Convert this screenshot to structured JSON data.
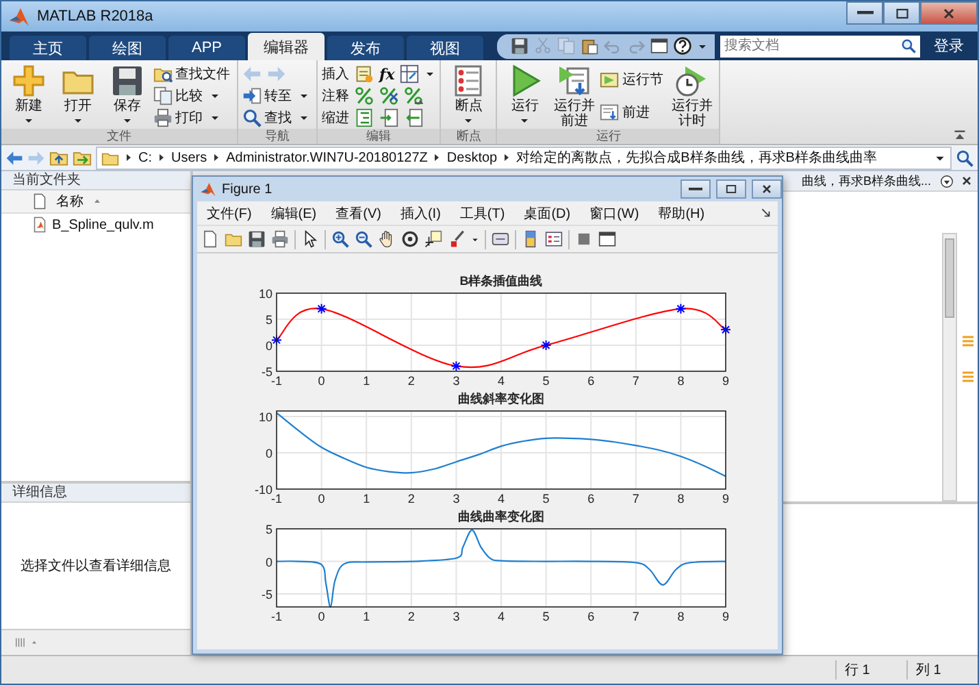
{
  "window": {
    "title": "MATLAB R2018a"
  },
  "tabs": [
    {
      "label": "主页",
      "selected": false
    },
    {
      "label": "绘图",
      "selected": false
    },
    {
      "label": "APP",
      "selected": false
    },
    {
      "label": "编辑器",
      "selected": true
    },
    {
      "label": "发布",
      "selected": false
    },
    {
      "label": "视图",
      "selected": false
    }
  ],
  "search": {
    "placeholder": "搜索文档"
  },
  "login": "登录",
  "ribbon": {
    "groups": [
      {
        "title": "文件",
        "columns": [
          {
            "kind": "large",
            "label": "新建",
            "dropdown": true
          },
          {
            "kind": "large",
            "label": "打开",
            "dropdown": true
          },
          {
            "kind": "large",
            "label": "保存",
            "dropdown": true
          },
          {
            "kind": "stack",
            "items": [
              {
                "kind": "button",
                "label": "查找文件",
                "dropdown": false
              },
              {
                "kind": "button",
                "label": "比较",
                "dropdown": true
              },
              {
                "kind": "button",
                "label": "打印",
                "dropdown": true
              }
            ]
          }
        ]
      },
      {
        "title": "导航",
        "columns": [
          {
            "kind": "stack",
            "items": [
              {
                "kind": "arrows",
                "disabled": true
              },
              {
                "kind": "button",
                "label": "转至",
                "dropdown": true
              },
              {
                "kind": "button",
                "label": "查找",
                "dropdown": true
              }
            ]
          }
        ]
      },
      {
        "title": "编辑",
        "columns": [
          {
            "kind": "stack",
            "items": [
              {
                "kind": "tools",
                "label": "插入",
                "glyph": "fx",
                "dropdown": true
              },
              {
                "kind": "tools",
                "label": "注释",
                "dropdown": false
              },
              {
                "kind": "tools",
                "label": "缩进",
                "dropdown": false
              }
            ]
          }
        ]
      },
      {
        "title": "断点",
        "columns": [
          {
            "kind": "large",
            "label": "断点",
            "dropdown": true
          }
        ]
      },
      {
        "title": "运行",
        "columns": [
          {
            "kind": "large",
            "label": "运行",
            "dropdown": true
          },
          {
            "kind": "large",
            "label": "运行并前进",
            "dropdown": false
          },
          {
            "kind": "stack",
            "items": [
              {
                "kind": "button",
                "label": "运行节",
                "dropdown": false
              },
              {
                "kind": "button",
                "label": "前进",
                "dropdown": false
              }
            ]
          },
          {
            "kind": "large",
            "label": "运行并计时",
            "dropdown": false
          }
        ]
      }
    ]
  },
  "path": {
    "segments": [
      "C:",
      "Users",
      "Administrator.WIN7U-20180127Z",
      "Desktop",
      "对给定的离散点，先拟合成B样条曲线，再求B样条曲线曲率"
    ]
  },
  "current_folder": {
    "title": "当前文件夹",
    "column": "名称",
    "files": [
      "B_Spline_qulv.m"
    ]
  },
  "details": {
    "title": "详细信息",
    "message": "选择文件以查看详细信息"
  },
  "editor": {
    "tab_title": "曲线，再求B样条曲线..."
  },
  "figure": {
    "title": "Figure 1",
    "menu": [
      "文件(F)",
      "编辑(E)",
      "查看(V)",
      "插入(I)",
      "工具(T)",
      "桌面(D)",
      "窗口(W)",
      "帮助(H)"
    ],
    "axes": [
      {
        "chart_data": {
          "type": "line",
          "grid": true,
          "title": "B样条插值曲线",
          "x": [
            -1,
            0,
            3,
            5,
            8,
            9
          ],
          "xlim": [
            -1,
            9
          ],
          "ylim": [
            -5,
            10
          ],
          "xticks": [
            -1,
            0,
            1,
            2,
            3,
            4,
            5,
            6,
            7,
            8,
            9
          ],
          "yticks": [
            -5,
            0,
            5,
            10
          ],
          "series": [
            {
              "type": "line",
              "color": "#ff0000",
              "values": [
                1,
                7,
                -4,
                0,
                7,
                3
              ]
            },
            {
              "type": "scatter",
              "color": "#0000ff",
              "values": [
                1,
                7,
                -4,
                0,
                7,
                3
              ]
            }
          ]
        }
      },
      {
        "chart_data": {
          "type": "line",
          "grid": true,
          "title": "曲线斜率变化图",
          "x": [
            -1,
            -0.5,
            0,
            0.5,
            1,
            1.5,
            2,
            2.5,
            3,
            3.5,
            4,
            4.5,
            5,
            5.5,
            6,
            6.5,
            7,
            7.5,
            8,
            8.5,
            9
          ],
          "xlim": [
            -1,
            9
          ],
          "ylim": [
            -10,
            11.5
          ],
          "xticks": [
            -1,
            0,
            1,
            2,
            3,
            4,
            5,
            6,
            7,
            8,
            9
          ],
          "yticks": [
            -10,
            0,
            10
          ],
          "series": [
            {
              "type": "line",
              "color": "#1f7fd0",
              "values": [
                11,
                6,
                1.5,
                -1.5,
                -4,
                -5.2,
                -5.5,
                -4.5,
                -2.5,
                -0.5,
                1.8,
                3.2,
                4,
                4,
                3.7,
                3,
                2,
                0.8,
                -1,
                -3.5,
                -6.5
              ]
            }
          ]
        }
      },
      {
        "chart_data": {
          "type": "line",
          "grid": true,
          "title": "曲线曲率变化图",
          "x": [
            -1,
            -0.5,
            0,
            0.1,
            0.2,
            0.3,
            0.5,
            1,
            2,
            3,
            3.15,
            3.35,
            3.55,
            3.75,
            4,
            5,
            6,
            7,
            7.3,
            7.6,
            7.9,
            8.2,
            9
          ],
          "xlim": [
            -1,
            9
          ],
          "ylim": [
            -7,
            5
          ],
          "xticks": [
            -1,
            0,
            1,
            2,
            3,
            4,
            5,
            6,
            7,
            8,
            9
          ],
          "yticks": [
            -5,
            0,
            5
          ],
          "series": [
            {
              "type": "line",
              "color": "#1f7fd0",
              "values": [
                0,
                0,
                -0.5,
                -3.5,
                -7,
                -3,
                -0.4,
                -0.1,
                0,
                0.5,
                2.2,
                4.8,
                2.2,
                0.5,
                0.1,
                0,
                0,
                -0.2,
                -1.2,
                -3.6,
                -1.2,
                -0.2,
                0
              ]
            }
          ]
        }
      }
    ]
  },
  "status": {
    "row": "行 1",
    "column": "列 1"
  }
}
